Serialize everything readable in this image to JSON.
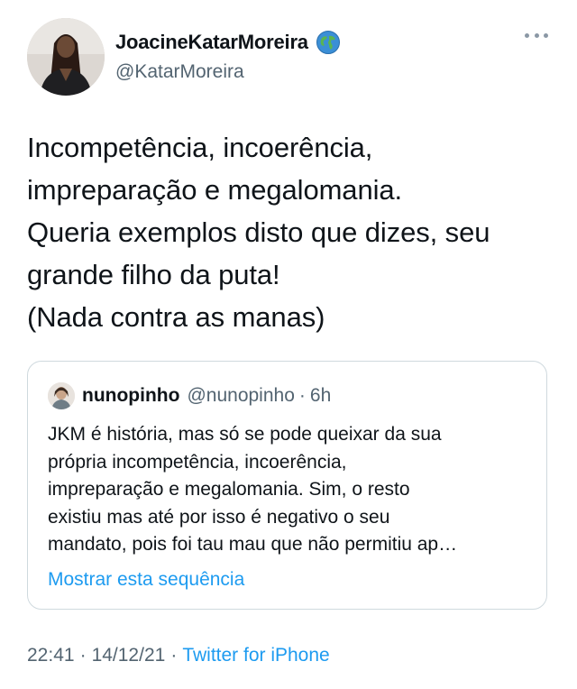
{
  "author": {
    "display_name": "JoacineKatarMoreira",
    "handle": "@KatarMoreira",
    "badge_icon": "globe-icon"
  },
  "tweet": {
    "lines": [
      "Incompetência, incoerência,",
      "impreparação e megalomania.",
      "Queria exemplos disto que dizes, seu",
      "grande filho da puta!",
      "(Nada contra as manas)"
    ]
  },
  "quote": {
    "name": "nunopinho",
    "handle": "@nunopinho",
    "dot": "·",
    "time": "6h",
    "lines": [
      "JKM é história, mas só se pode queixar da sua",
      "própria incompetência, incoerência,",
      "impreparação e megalomania. Sim, o resto",
      "existiu mas até por isso é negativo o seu",
      "mandato, pois foi tau mau que não permitiu ap…"
    ],
    "show_thread": "Mostrar esta sequência"
  },
  "meta": {
    "time": "22:41",
    "sep1": "·",
    "date": "14/12/21",
    "sep2": "·",
    "source": "Twitter for iPhone"
  },
  "colors": {
    "text": "#0f1419",
    "secondary": "#536471",
    "link": "#1d9bf0",
    "border": "#cfd9de"
  }
}
